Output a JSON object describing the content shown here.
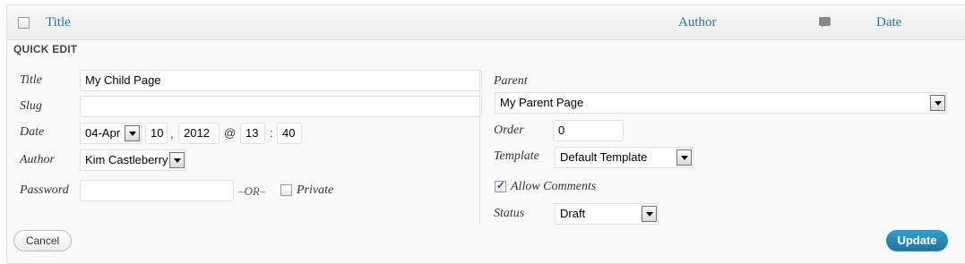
{
  "table_header": {
    "title": "Title",
    "author": "Author",
    "comments_icon": "comment-bubble-icon",
    "date": "Date"
  },
  "quick_edit": {
    "heading": "QUICK EDIT",
    "title_label": "Title",
    "title_value": "My Child Page",
    "slug_label": "Slug",
    "slug_value": "",
    "date_label": "Date",
    "date_month": "04-Apr",
    "date_day": "10",
    "date_sep1": ",",
    "date_year": "2012",
    "date_at": "@",
    "date_hour": "13",
    "date_colon": ":",
    "date_minute": "40",
    "author_label": "Author",
    "author_value": "Kim Castleberry",
    "password_label": "Password",
    "password_value": "",
    "or_text": "–OR–",
    "private_label": "Private",
    "private_checked": false,
    "parent_label": "Parent",
    "parent_value": "My Parent Page",
    "order_label": "Order",
    "order_value": "0",
    "template_label": "Template",
    "template_value": "Default Template",
    "allow_comments_label": "Allow Comments",
    "allow_comments_checked": true,
    "status_label": "Status",
    "status_value": "Draft",
    "cancel_label": "Cancel",
    "update_label": "Update"
  },
  "colors": {
    "link": "#21759b",
    "update_button": "#21759b"
  }
}
